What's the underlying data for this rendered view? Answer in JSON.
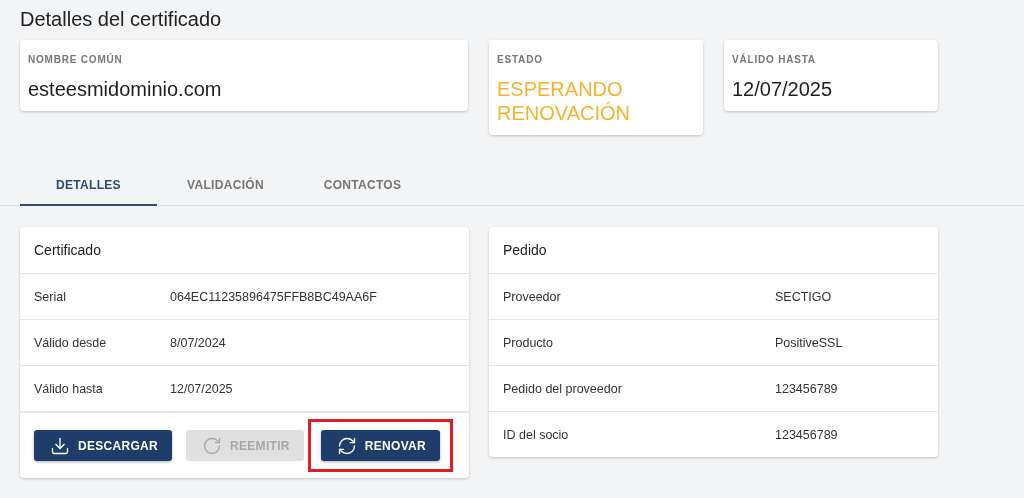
{
  "title": "Detalles del certificado",
  "summary": [
    {
      "label": "NOMBRE COMÚN",
      "value": "esteesmidominio.com",
      "kind": "value"
    },
    {
      "label": "ESTADO",
      "value": "ESPERANDO RENOVACIÓN",
      "kind": "status"
    },
    {
      "label": "VÁLIDO HASTA",
      "value": "12/07/2025",
      "kind": "value"
    }
  ],
  "tabs": [
    {
      "label": "DETALLES",
      "selected": true
    },
    {
      "label": "VALIDACIÓN",
      "selected": false
    },
    {
      "label": "CONTACTOS",
      "selected": false
    }
  ],
  "panels": [
    {
      "title": "Certificado",
      "rows": [
        {
          "label": "Serial",
          "value": "064EC11235896475FFB8BC49AA6F"
        },
        {
          "label": "Válido desde",
          "value": "8/07/2024"
        },
        {
          "label": "Válido hasta",
          "value": "12/07/2025"
        }
      ],
      "buttons": [
        {
          "label": "DESCARGAR",
          "disabled": false,
          "highlighted": false
        },
        {
          "label": "REEMITIR",
          "disabled": true,
          "highlighted": false
        },
        {
          "label": "RENOVAR",
          "disabled": false,
          "highlighted": true
        }
      ]
    },
    {
      "title": "Pedido",
      "rows": [
        {
          "label": "Proveedor",
          "value": "SECTIGO"
        },
        {
          "label": "Producto",
          "value": "PositiveSSL"
        },
        {
          "label": "Pedido del proveedor",
          "value": "123456789"
        },
        {
          "label": "ID del socio",
          "value": "123456789"
        }
      ]
    }
  ]
}
